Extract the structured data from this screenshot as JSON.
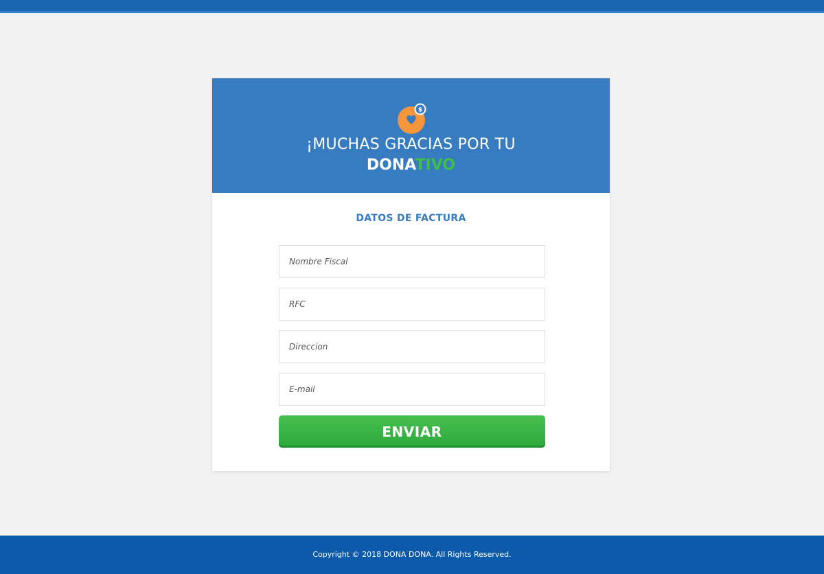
{
  "header": {
    "line1": "¡MUCHAS GRACIAS POR TU",
    "brand_part1": "DONA",
    "brand_part2": "TIVO"
  },
  "logo": {
    "icon": "heart-coin-icon",
    "coin_symbol": "$"
  },
  "form": {
    "title": "DATOS DE FACTURA",
    "fields": [
      {
        "placeholder": "Nombre Fiscal",
        "value": ""
      },
      {
        "placeholder": "RFC",
        "value": ""
      },
      {
        "placeholder": "Direccion",
        "value": ""
      },
      {
        "placeholder": "E-mail",
        "value": ""
      }
    ],
    "submit_label": "ENVIAR"
  },
  "footer": {
    "copyright": "Copyright © 2018 DONA DONA. All Rights Reserved."
  },
  "colors": {
    "header_blue": "#377bc0",
    "footer_blue": "#0c5aa9",
    "accent_green": "#3fbf4a",
    "logo_orange": "#f7953b"
  }
}
